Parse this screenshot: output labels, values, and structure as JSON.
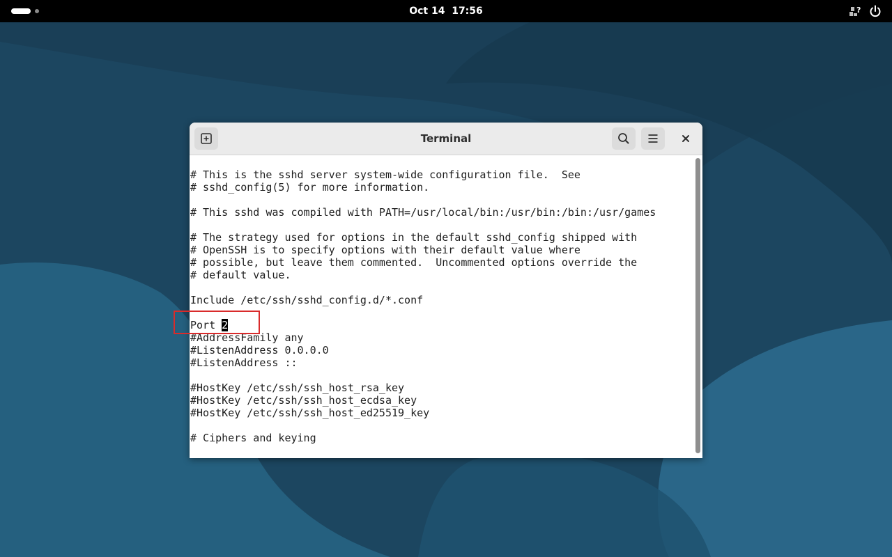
{
  "topbar": {
    "clock_date": "Oct 14",
    "clock_time": "17:56",
    "activities_icon": "activities-pill-icon",
    "network_icon": "network-unknown-icon",
    "power_icon": "power-icon"
  },
  "window": {
    "title": "Terminal",
    "new_tab_icon": "new-tab-icon",
    "search_icon": "search-icon",
    "menu_icon": "hamburger-menu-icon",
    "close_icon": "close-icon"
  },
  "terminal": {
    "lines_before": [
      "# This is the sshd server system-wide configuration file.  See",
      "# sshd_config(5) for more information.",
      "",
      "# This sshd was compiled with PATH=/usr/local/bin:/usr/bin:/bin:/usr/games",
      "",
      "# The strategy used for options in the default sshd_config shipped with",
      "# OpenSSH is to specify options with their default value where",
      "# possible, but leave them commented.  Uncommented options override the",
      "# default value.",
      "",
      "Include /etc/ssh/sshd_config.d/*.conf",
      ""
    ],
    "cursor_line_text": "Port 2",
    "cursor_char": "2",
    "lines_after": [
      "#AddressFamily any",
      "#ListenAddress 0.0.0.0",
      "#ListenAddress ::",
      "",
      "#HostKey /etc/ssh/ssh_host_rsa_key",
      "#HostKey /etc/ssh/ssh_host_ecdsa_key",
      "#HostKey /etc/ssh/ssh_host_ed25519_key",
      "",
      "# Ciphers and keying"
    ]
  },
  "colors": {
    "desktop_bg": "#1f4a63",
    "topbar_bg": "#000000",
    "highlight_box": "#d92b2b",
    "headerbar_bg": "#ebebeb"
  }
}
